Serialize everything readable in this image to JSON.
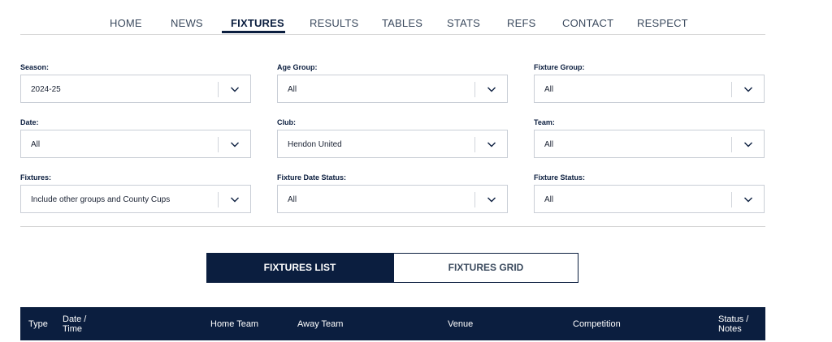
{
  "nav": {
    "items": [
      {
        "label": "HOME"
      },
      {
        "label": "NEWS"
      },
      {
        "label": "FIXTURES",
        "active": true
      },
      {
        "label": "RESULTS"
      },
      {
        "label": "TABLES"
      },
      {
        "label": "STATS"
      },
      {
        "label": "REFS"
      },
      {
        "label": "CONTACT"
      },
      {
        "label": "RESPECT"
      }
    ]
  },
  "filters": {
    "season": {
      "label": "Season:",
      "value": "2024-25"
    },
    "age_group": {
      "label": "Age Group:",
      "value": "All"
    },
    "fixture_group": {
      "label": "Fixture Group:",
      "value": "All"
    },
    "date": {
      "label": "Date:",
      "value": "All"
    },
    "club": {
      "label": "Club:",
      "value": "Hendon United"
    },
    "team": {
      "label": "Team:",
      "value": "All"
    },
    "fixtures": {
      "label": "Fixtures:",
      "value": "Include other groups and County Cups"
    },
    "fixture_date_status": {
      "label": "Fixture Date Status:",
      "value": "All"
    },
    "fixture_status": {
      "label": "Fixture Status:",
      "value": "All"
    }
  },
  "view_toggle": {
    "list_label": "FIXTURES LIST",
    "grid_label": "FIXTURES GRID",
    "selected": "list"
  },
  "table": {
    "headers": {
      "type": "Type",
      "date_line1": "Date /",
      "date_line2": "Time",
      "home_team": "Home Team",
      "away_team": "Away Team",
      "venue": "Venue",
      "competition": "Competition",
      "status_line1": "Status /",
      "status_line2": "Notes"
    }
  },
  "colors": {
    "navy": "#0b1e3f",
    "border": "#c9ced6",
    "muted_text": "#3b4a5e"
  }
}
